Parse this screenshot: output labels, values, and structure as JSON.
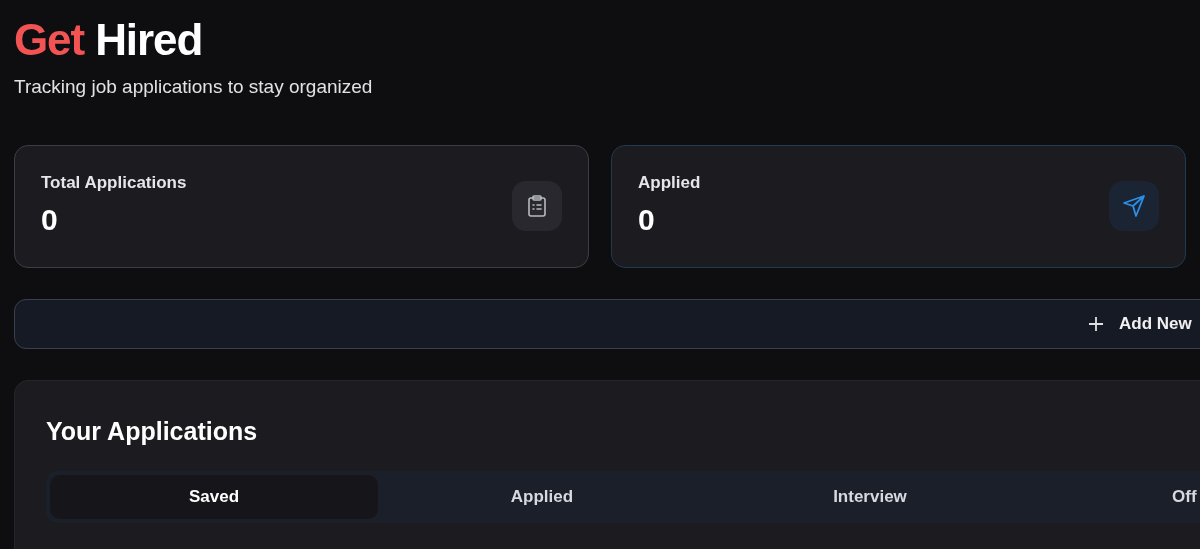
{
  "header": {
    "title_accent": "Get",
    "title": "Hired",
    "subtitle": "Tracking job applications to stay organized"
  },
  "stats": [
    {
      "label": "Total Applications",
      "value": "0",
      "kind": "total"
    },
    {
      "label": "Applied",
      "value": "0",
      "kind": "applied"
    }
  ],
  "add_button": {
    "label": "Add New"
  },
  "applications": {
    "title": "Your Applications",
    "tabs": [
      {
        "label": "Saved",
        "selected": true
      },
      {
        "label": "Applied",
        "selected": false
      },
      {
        "label": "Interview",
        "selected": false
      },
      {
        "label": "Off",
        "selected": false
      }
    ]
  }
}
